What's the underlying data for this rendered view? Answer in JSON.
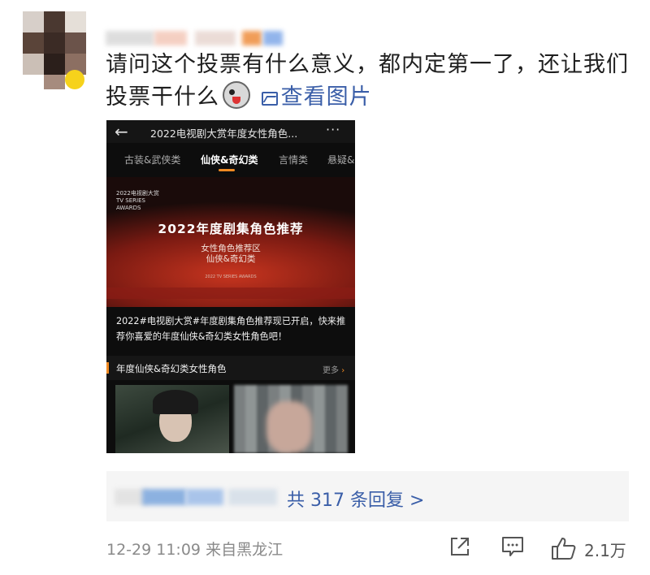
{
  "comment": {
    "text": "请问这个投票有什么意义，都内定第一了，还让我们投票干什么",
    "emoji_icon": "grinning-dog-emoji-icon",
    "image_link_label": "查看图片",
    "image_link_icon": "image-icon"
  },
  "screenshot": {
    "header_title": "2022电视剧大赏年度女性角色...",
    "back_icon": "arrow-left-icon",
    "more_icon": "ellipsis-icon",
    "tabs": [
      "古装&武侠类",
      "仙侠&奇幻类",
      "言情类",
      "悬疑&"
    ],
    "active_tab": "仙侠&奇幻类",
    "banner": {
      "logo": "2022电视剧大赏\nTV SERIES\nAWARDS",
      "title": "2022年度剧集角色推荐",
      "subtitle_1": "女性角色推荐区",
      "subtitle_2": "仙侠&奇幻类",
      "footer": "2022 TV SERIES AWARDS"
    },
    "description": "2022#电视剧大赏#年度剧集角色推荐现已开启，快来推荐你喜爱的年度仙侠&奇幻类女性角色吧！",
    "section_title": "年度仙侠&奇幻类女性角色",
    "section_more": "更多"
  },
  "replies": {
    "label": "共 317 条回复 >"
  },
  "footer": {
    "timestamp": "12-29 11:09",
    "location": "来自黑龙江",
    "like_count": "2.1万"
  },
  "colors": {
    "link": "#3a5ea8",
    "accent_orange": "#f08a22",
    "meta_gray": "#8a8a8a"
  }
}
